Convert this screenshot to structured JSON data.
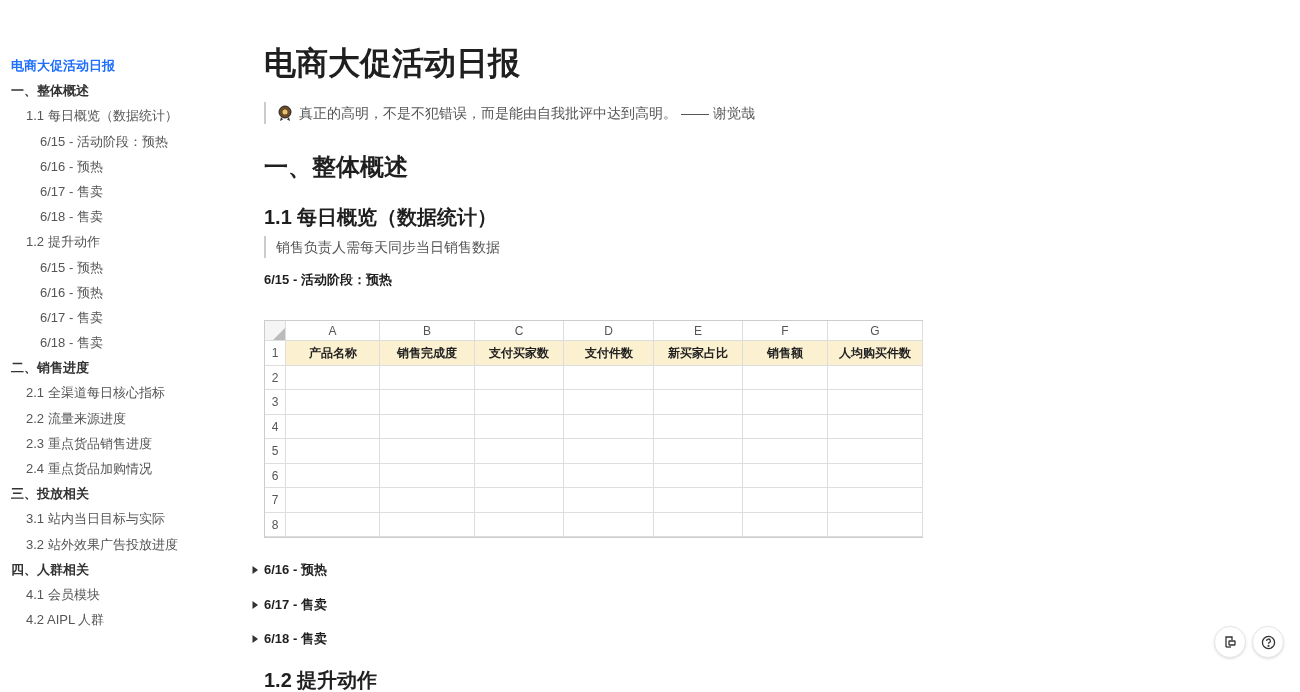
{
  "toc": [
    {
      "label": "电商大促活动日报",
      "selected": true
    },
    {
      "label": "一、整体概述",
      "selected": false,
      "children": [
        {
          "label": "1.1 每日概览（数据统计）",
          "selected": false,
          "children": [
            {
              "label": "6/15 - 活动阶段：预热",
              "selected": false
            },
            {
              "label": "6/16 - 预热",
              "selected": false
            },
            {
              "label": "6/17 - 售卖",
              "selected": false
            },
            {
              "label": "6/18 - 售卖",
              "selected": false
            }
          ]
        },
        {
          "label": "1.2 提升动作",
          "selected": false,
          "children": [
            {
              "label": "6/15 - 预热",
              "selected": false
            },
            {
              "label": "6/16 - 预热",
              "selected": false
            },
            {
              "label": "6/17 - 售卖",
              "selected": false
            },
            {
              "label": "6/18 - 售卖",
              "selected": false
            }
          ]
        }
      ]
    },
    {
      "label": "二、销售进度",
      "selected": false,
      "children": [
        {
          "label": "2.1 全渠道每日核心指标",
          "selected": false
        },
        {
          "label": "2.2 流量来源进度",
          "selected": false
        },
        {
          "label": "2.3 重点货品销售进度",
          "selected": false
        },
        {
          "label": "2.4 重点货品加购情况",
          "selected": false
        }
      ]
    },
    {
      "label": "三、投放相关",
      "selected": false,
      "children": [
        {
          "label": "3.1 站内当日目标与实际",
          "selected": false
        },
        {
          "label": "3.2 站外效果广告投放进度",
          "selected": false
        }
      ]
    },
    {
      "label": "四、人群相关",
      "selected": false,
      "children": [
        {
          "label": "4.1 会员模块",
          "selected": false
        },
        {
          "label": "4.2 AIPL 人群",
          "selected": false
        }
      ]
    }
  ],
  "doc": {
    "title": "电商大促活动日报",
    "blocks": [
      {
        "kind": "quote",
        "icon": true,
        "text": "真正的高明，不是不犯错误，而是能由自我批评中达到高明。 —— 谢觉哉"
      },
      {
        "kind": "h1",
        "text": "一、整体概述"
      },
      {
        "kind": "h2",
        "text": "1.1 每日概览（数据统计）"
      },
      {
        "kind": "quote",
        "icon": false,
        "text": "销售负责人需每天同步当日销售数据"
      },
      {
        "kind": "h4",
        "text": "6/15 - 活动阶段：预热"
      },
      {
        "kind": "sheet",
        "columns": [
          "A",
          "B",
          "C",
          "D",
          "E",
          "F",
          "G"
        ],
        "row_numbers": [
          "1",
          "2",
          "3",
          "4",
          "5",
          "6",
          "7",
          "8"
        ],
        "header": [
          "产品名称",
          "销售完成度",
          "支付买家数",
          "支付件数",
          "新买家占比",
          "销售额",
          "人均购买件数"
        ]
      },
      {
        "kind": "toggle",
        "expanded": false,
        "text": "6/16 - 预热"
      },
      {
        "kind": "toggle",
        "expanded": false,
        "text": "6/17 - 售卖"
      },
      {
        "kind": "toggle",
        "expanded": false,
        "text": "6/18 - 售卖"
      },
      {
        "kind": "h2",
        "text": "1.2 提升动作"
      }
    ]
  }
}
